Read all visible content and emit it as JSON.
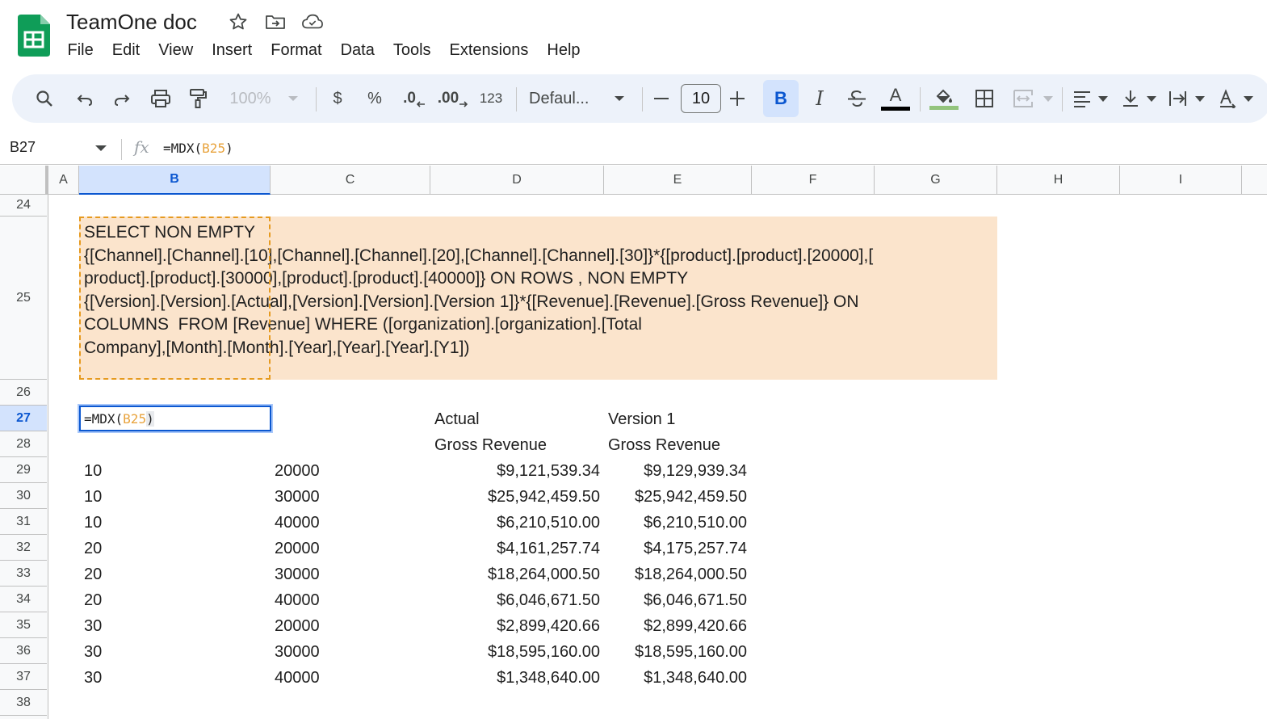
{
  "document": {
    "title": "TeamOne doc"
  },
  "menu": [
    "File",
    "Edit",
    "View",
    "Insert",
    "Format",
    "Data",
    "Tools",
    "Extensions",
    "Help"
  ],
  "toolbar": {
    "zoom": "100%",
    "currency": "$",
    "percent": "%",
    "decrease_decimals": ".0",
    "increase_decimals": ".00",
    "number_format": "123",
    "font": "Defaul...",
    "font_size": "10",
    "bold": "B",
    "italic": "I",
    "text_color": "A"
  },
  "formula_bar": {
    "cell_ref": "B27",
    "fx": "fx",
    "formula_prefix": "=MDX(",
    "formula_ref": "B25",
    "formula_suffix": ")"
  },
  "columns": [
    "A",
    "B",
    "C",
    "D",
    "E",
    "F",
    "G",
    "H",
    "I"
  ],
  "selected_column": "B",
  "rows": [
    "24",
    "25",
    "26",
    "27",
    "28",
    "29",
    "30",
    "31",
    "32",
    "33",
    "34",
    "35",
    "36",
    "37",
    "38"
  ],
  "selected_row": "27",
  "mdx_query": "SELECT NON EMPTY\n{[Channel].[Channel].[10],[Channel].[Channel].[20],[Channel].[Channel].[30]}*{[product].[product].[20000],[\nproduct].[product].[30000],[product].[product].[40000]} ON ROWS , NON EMPTY\n{[Version].[Version].[Actual],[Version].[Version].[Version 1]}*{[Revenue].[Revenue].[Gross Revenue]} ON\nCOLUMNS  FROM [Revenue] WHERE ([organization].[organization].[Total\nCompany],[Month].[Month].[Year],[Year].[Year].[Y1])",
  "active_cell_content": {
    "prefix": "=MDX(",
    "ref": "B25",
    "suffix": ")"
  },
  "result_headers": {
    "row27": [
      "Actual",
      "Version 1"
    ],
    "row28": [
      "Gross Revenue",
      "Gross Revenue"
    ]
  },
  "result_rows": [
    [
      "10",
      "20000",
      "$9,121,539.34",
      "$9,129,939.34"
    ],
    [
      "10",
      "30000",
      "$25,942,459.50",
      "$25,942,459.50"
    ],
    [
      "10",
      "40000",
      "$6,210,510.00",
      "$6,210,510.00"
    ],
    [
      "20",
      "20000",
      "$4,161,257.74",
      "$4,175,257.74"
    ],
    [
      "20",
      "30000",
      "$18,264,000.50",
      "$18,264,000.50"
    ],
    [
      "20",
      "40000",
      "$6,046,671.50",
      "$6,046,671.50"
    ],
    [
      "30",
      "20000",
      "$2,899,420.66",
      "$2,899,420.66"
    ],
    [
      "30",
      "30000",
      "$18,595,160.00",
      "$18,595,160.00"
    ],
    [
      "30",
      "40000",
      "$1,348,640.00",
      "$1,348,640.00"
    ]
  ],
  "colors": {
    "accent": "#0b57d0",
    "selection": "#d3e3fd",
    "query_fill": "#fbe4cc",
    "reference": "#e8a33d",
    "sheets_green": "#0f9d58"
  }
}
